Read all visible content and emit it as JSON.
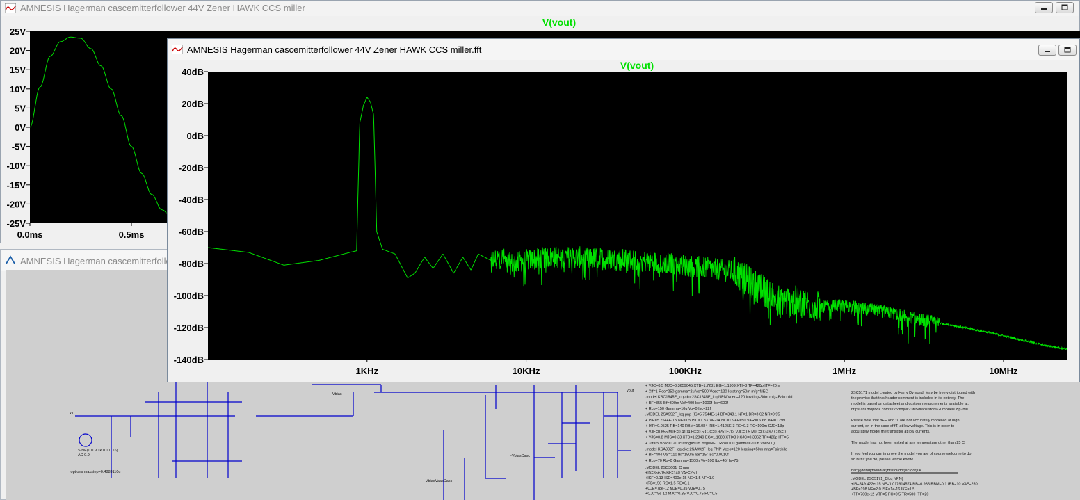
{
  "windows": {
    "back_plot": {
      "title": "AMNESIS Hagerman cascemitterfollower 44V Zener HAWK CCS miller",
      "trace_title": "V(vout)",
      "y_ticks": [
        "25V",
        "20V",
        "15V",
        "10V",
        "5V",
        "0V",
        "-5V",
        "-10V",
        "-15V",
        "-20V",
        "-25V"
      ],
      "x_ticks": [
        "0.0ms",
        "0.5ms"
      ]
    },
    "schematic": {
      "title": "AMNESIS Hagerman cascemitterfollower",
      "labels": {
        "sine": "SINE(0 0.9 1k 0 0 0 16)",
        "ac": "AC 0.9",
        "options": ".options maxstep=0.4883110u",
        "vin": "vin",
        "vbias": "-Vbias",
        "vbias_casc": "-VbiasVaacCasc",
        "vbias_casc2": "-VbiasCasc",
        "vout": "vout"
      },
      "models_left": [
        "+ VJC=0.5 MJC=0.3659045 XTB=1.7281 EG=1.1909 XTI=3 TF=420p ITF=20m",
        "+ Xtf=1 Rco=250 gamma=2u Vo=500 Vceo=120 Icrating=50m mfg=NEC",
        ".model KSC1845F_lcq ako:2SC1845E_lcq NPN Vceo=120 Icrating=50m mfg=Fairchild",
        "+ BF=355 Ikf=300m Vaf=400 Ise=1000f Ibc=600f",
        "+ Rco=150 Gamma=10u Vo=0 Isc=22f",
        ".MODEL 2SA992F_lcq pnp (IS=5.7544E-14 BF=348.1 NF=1 BR=3.62 NR=0.95",
        "+ ISE=5.7544E-15 NE=1.5 ISC=1.8378E-14 NC=1 VAF=50 VAR=16.68 IKF=0.299",
        "+ IKR=0.0525 RB=140 RBM=16.084 IRB=1.4125E-3 RE=0.3 RC=100m CJE=13p",
        "+ VJE=0.855 MJE=0.4104 FC=0.5 CJC=0.9251E-12 VJC=0.5 MJC=0.3497 CJS=0",
        "+ VJS=0.8 MJS=0.33 XTB=1.2849 EG=1.1683 XTI=3 XCJC=0.3862 TF=420p ITF=5",
        "+ Xtf=.5 Vceo=120 Icrating=50m mfg=NEC Rco=100 gamma=200n Vo=500)",
        ".model KSA992F_lcq ako:2SA992F_lcq PNP Vceo=120 Icrating=50m mfg=Fairchild",
        "+ BF=404 Vaf=110 Ikf=150m Ise=15f Isc=0.0010f",
        "+ Rco=70 Ro=0 Gamma=1500n Vo=100 Ibc=45f Is=75f"
      ],
      "models_mid": [
        ".MODEL 2SC3601_C npn",
        "+IS=85e-15     BF=140             VAF=250",
        "+IKF=0.13      ISE=400e-15   NE=1.5                    NF=1.0",
        "+RB=150        RC=1.5                   RE=0.1",
        "+CJE=78e-12   MJE=0.35     VJE=0.75",
        "+CJC=9e-12    MJC=0.35     VJC=0.75     FC=0.5"
      ],
      "notes_right": [
        "2SC5171 model created by Harry Dymond. May be freely distributed with",
        "the proviso that this header comment is included in its entirety. The",
        "model is based on datasheet and custom measurements available at:",
        "https://dl.dropbox.com/u/V5mdjwit23fs5/transistor%20models.zip?dl=1",
        "",
        "Please note that hFE and fT are not accurately modelled at high",
        "current, or, in the case of fT, at low voltage. This is in order to",
        "accurately model the transistor at low currents.",
        "",
        "The model has not been tested at any temperature other than 25 C",
        "",
        "If you feel you can improve the model you are of course welcome to do",
        "so but if you do, please let me know!",
        "",
        "harry(dot)dymond(at)bristol(dot)ac(dot)uk"
      ],
      "models_right": [
        ".MODEL 2SC5171_Dlcq NPN(",
        "+IS=549.422e-15 NF=1.017914574 RB=0.935 RBM=0.1 IRB=10 VAF=250",
        "+BF=198 NE=2.0 ISE=1e-16 IKF=1.5",
        "+TF=700e-12 VTF=5 FC=0.5 TR=500 ITF=20"
      ]
    },
    "fft": {
      "title": "AMNESIS Hagerman cascemitterfollower 44V Zener HAWK CCS miller.fft",
      "trace_title": "V(vout)"
    }
  },
  "chart_data": [
    {
      "type": "line",
      "title": "V(vout)",
      "xlabel": "",
      "ylabel": "",
      "x_unit": "ms",
      "y_unit": "V",
      "xlim": [
        0,
        1.0
      ],
      "ylim": [
        -25,
        25
      ],
      "grid": false,
      "series": [
        {
          "name": "V(vout)",
          "color": "#00e000",
          "x": [
            0,
            0.05,
            0.1,
            0.15,
            0.2,
            0.25,
            0.3,
            0.35,
            0.4,
            0.45,
            0.5,
            0.55,
            0.6,
            0.65,
            0.7
          ],
          "y": [
            0,
            10.5,
            18.5,
            22.3,
            23.5,
            23.2,
            20.5,
            16.0,
            10.0,
            3.0,
            -5.0,
            -12.0,
            -17.5,
            -21.5,
            -23.5
          ]
        }
      ]
    },
    {
      "type": "line",
      "title": "V(vout)",
      "xlabel": "",
      "ylabel": "",
      "x_scale": "log",
      "x_unit": "Hz",
      "y_unit": "dB",
      "xlim": [
        100,
        25000000
      ],
      "ylim": [
        -140,
        40
      ],
      "y_ticks": [
        "40dB",
        "20dB",
        "0dB",
        "-20dB",
        "-40dB",
        "-60dB",
        "-80dB",
        "-100dB",
        "-120dB",
        "-140dB"
      ],
      "x_ticks": [
        {
          "value": 1000,
          "label": "1KHz"
        },
        {
          "value": 10000,
          "label": "10KHz"
        },
        {
          "value": 100000,
          "label": "100KHz"
        },
        {
          "value": 1000000,
          "label": "1MHz"
        },
        {
          "value": 10000000,
          "label": "10MHz"
        }
      ],
      "grid": false,
      "series": [
        {
          "name": "V(vout)",
          "color": "#00e000",
          "x": [
            100,
            180,
            300,
            500,
            780,
            860,
            900,
            950,
            1000,
            1050,
            1100,
            1150,
            1250,
            1500,
            1800,
            2000,
            2300,
            2600,
            3000,
            3500,
            4000,
            4500,
            5000,
            6000,
            7000,
            8000,
            10000,
            14000,
            20000,
            30000,
            50000,
            80000,
            120000,
            200000,
            300000,
            400000,
            500000,
            700000,
            1000000,
            1500000,
            2000000,
            3000000,
            5000000,
            8000000,
            12000000,
            18000000,
            25000000
          ],
          "y": [
            -70,
            -73,
            -81,
            -78,
            -73,
            -72,
            8,
            19,
            24,
            21,
            13,
            -60,
            -71,
            -74,
            -89,
            -86,
            -76,
            -83,
            -74,
            -86,
            -76,
            -84,
            -74,
            -78,
            -76,
            -80,
            -78,
            -76,
            -76,
            -77,
            -78,
            -80,
            -82,
            -85,
            -96,
            -103,
            -104,
            -107,
            -106,
            -109,
            -111,
            -115,
            -119,
            -123,
            -127,
            -131,
            -133.5
          ]
        }
      ]
    }
  ]
}
